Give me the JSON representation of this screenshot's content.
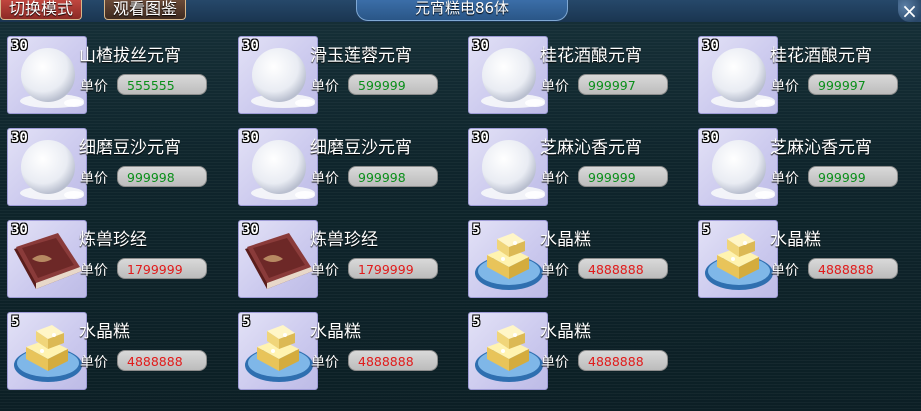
{
  "header": {
    "switch_mode": "切换模式",
    "view_gallery": "观看图鉴",
    "title": "元宵糕电86体",
    "close_glyph": "×"
  },
  "price_label": "单价",
  "colors": {
    "price_low": "#0a8f1a",
    "price_high": "#e11b1b"
  },
  "items": [
    {
      "count": "30",
      "name": "山楂拔丝元宵",
      "price": "555555",
      "icon": "snowball-icon",
      "price_color": "green"
    },
    {
      "count": "30",
      "name": "滑玉莲蓉元宵",
      "price": "599999",
      "icon": "snowball-icon",
      "price_color": "green"
    },
    {
      "count": "30",
      "name": "桂花酒酿元宵",
      "price": "999997",
      "icon": "snowball-icon",
      "price_color": "green"
    },
    {
      "count": "30",
      "name": "桂花酒酿元宵",
      "price": "999997",
      "icon": "snowball-icon",
      "price_color": "green"
    },
    {
      "count": "30",
      "name": "细磨豆沙元宵",
      "price": "999998",
      "icon": "snowball-icon",
      "price_color": "green"
    },
    {
      "count": "30",
      "name": "细磨豆沙元宵",
      "price": "999998",
      "icon": "snowball-icon",
      "price_color": "green"
    },
    {
      "count": "30",
      "name": "芝麻沁香元宵",
      "price": "999999",
      "icon": "snowball-icon",
      "price_color": "green"
    },
    {
      "count": "30",
      "name": "芝麻沁香元宵",
      "price": "999999",
      "icon": "snowball-icon",
      "price_color": "green"
    },
    {
      "count": "30",
      "name": "炼兽珍经",
      "price": "1799999",
      "icon": "book-icon",
      "price_color": "red"
    },
    {
      "count": "30",
      "name": "炼兽珍经",
      "price": "1799999",
      "icon": "book-icon",
      "price_color": "red"
    },
    {
      "count": "5",
      "name": "水晶糕",
      "price": "4888888",
      "icon": "crystal-cake-icon",
      "price_color": "red"
    },
    {
      "count": "5",
      "name": "水晶糕",
      "price": "4888888",
      "icon": "crystal-cake-icon",
      "price_color": "red"
    },
    {
      "count": "5",
      "name": "水晶糕",
      "price": "4888888",
      "icon": "crystal-cake-icon",
      "price_color": "red"
    },
    {
      "count": "5",
      "name": "水晶糕",
      "price": "4888888",
      "icon": "crystal-cake-icon",
      "price_color": "red"
    },
    {
      "count": "5",
      "name": "水晶糕",
      "price": "4888888",
      "icon": "crystal-cake-icon",
      "price_color": "red"
    }
  ]
}
